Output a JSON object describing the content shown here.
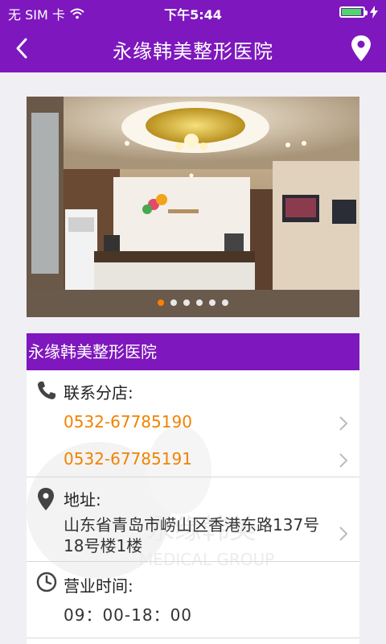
{
  "status_bar": {
    "carrier": "无 SIM 卡",
    "time": "下午5:44"
  },
  "nav": {
    "title": "永缘韩美整形医院",
    "back_icon": "chevron-left-icon",
    "location_icon": "map-pin-icon"
  },
  "carousel": {
    "slide_count": 6,
    "active_index": 0
  },
  "card": {
    "header": "永缘韩美整形医院",
    "contact_label": "联系分店:",
    "phones": [
      "0532-67785190",
      "0532-67785191"
    ],
    "address_label": "地址:",
    "address": "山东省青岛市崂山区香港东路137号18号楼1楼",
    "hours_label": "营业时间:",
    "hours": "09：00-18：00"
  },
  "colors": {
    "brand_purple": "#7e17bd",
    "phone_orange": "#f08300",
    "dot_active": "#ff7f00"
  }
}
